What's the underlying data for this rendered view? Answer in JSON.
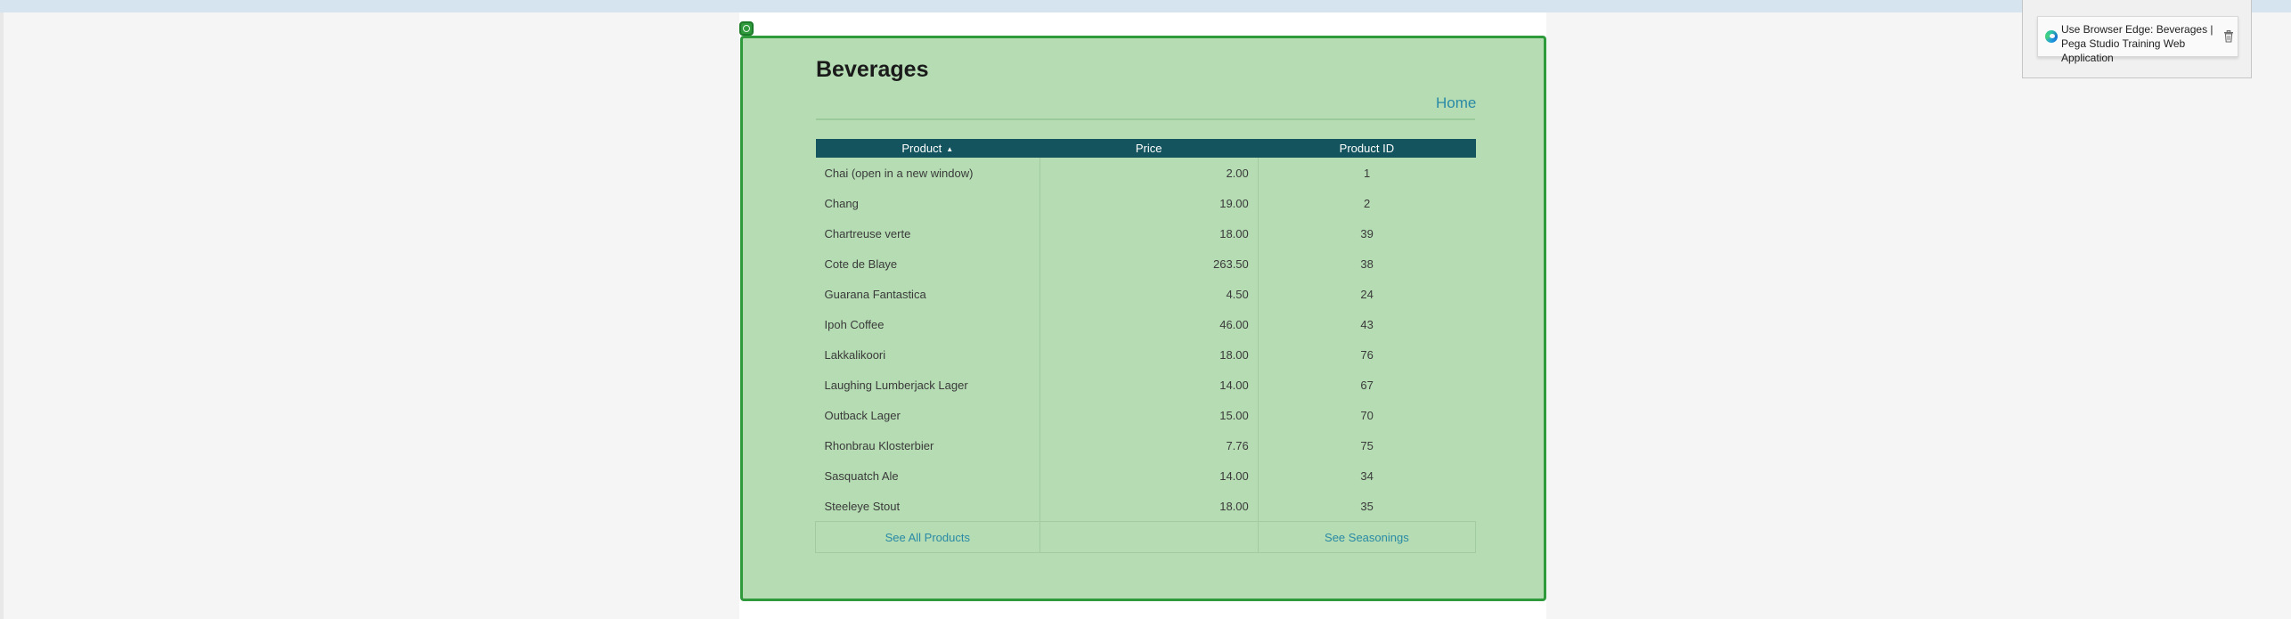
{
  "page": {
    "title": "Beverages",
    "home_label": "Home"
  },
  "table": {
    "columns": [
      {
        "label": "Product",
        "sorted": "ascending"
      },
      {
        "label": "Price"
      },
      {
        "label": "Product ID"
      }
    ],
    "rows": [
      {
        "product": "Chai  (open in a new window)",
        "price": "2.00",
        "id": "1"
      },
      {
        "product": "Chang",
        "price": "19.00",
        "id": "2"
      },
      {
        "product": "Chartreuse verte",
        "price": "18.00",
        "id": "39"
      },
      {
        "product": "Cote de Blaye",
        "price": "263.50",
        "id": "38"
      },
      {
        "product": "Guarana Fantastica",
        "price": "4.50",
        "id": "24"
      },
      {
        "product": "Ipoh Coffee",
        "price": "46.00",
        "id": "43"
      },
      {
        "product": "Lakkalikoori",
        "price": "18.00",
        "id": "76"
      },
      {
        "product": "Laughing Lumberjack Lager",
        "price": "14.00",
        "id": "67"
      },
      {
        "product": "Outback Lager",
        "price": "15.00",
        "id": "70"
      },
      {
        "product": "Rhonbrau Klosterbier",
        "price": "7.76",
        "id": "75"
      },
      {
        "product": "Sasquatch Ale",
        "price": "14.00",
        "id": "34"
      },
      {
        "product": "Steeleye Stout",
        "price": "18.00",
        "id": "35"
      }
    ],
    "footer": {
      "all_products": "See All Products",
      "seasonings": "See Seasonings"
    }
  },
  "notification": {
    "text": "Use Browser Edge: Beverages | Pega Studio Training Web Application",
    "icon": "edge-browser-icon",
    "delete_icon": "trash-icon"
  },
  "colors": {
    "frame_fill": "#b5dcb3",
    "frame_border": "#2e9a3c",
    "header_bg": "#14545e",
    "link": "#2a8aa6"
  }
}
